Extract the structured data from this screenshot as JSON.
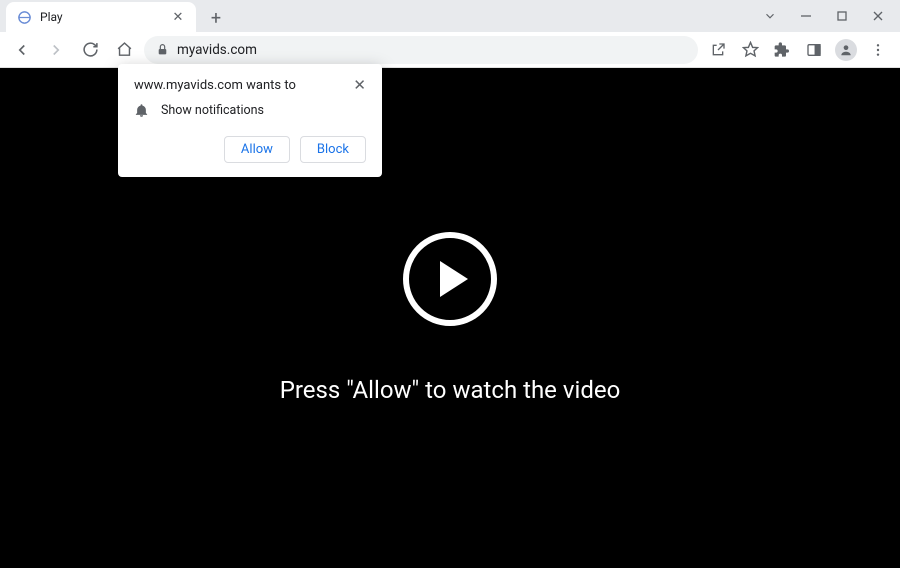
{
  "tab": {
    "title": "Play"
  },
  "address": {
    "url": "myavids.com"
  },
  "permission": {
    "title": "www.myavids.com wants to",
    "item": "Show notifications",
    "allow": "Allow",
    "block": "Block"
  },
  "page": {
    "message": "Press \"Allow\" to watch the video"
  }
}
